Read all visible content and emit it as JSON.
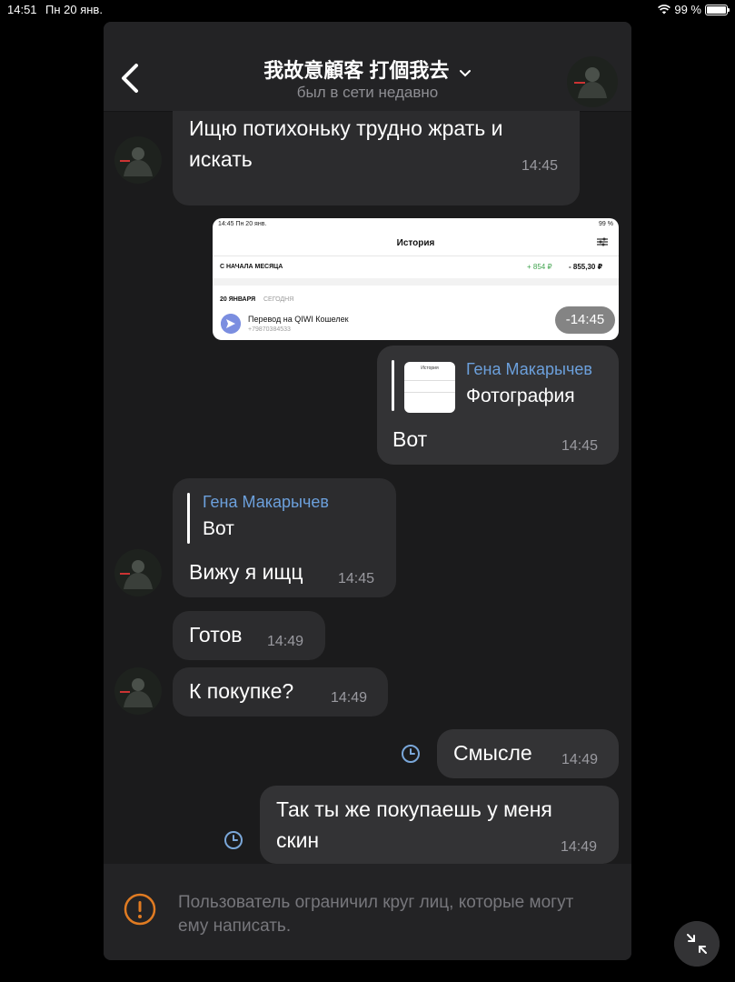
{
  "status_bar": {
    "time": "14:51",
    "date": "Пн 20 янв.",
    "battery": "99 %"
  },
  "chat": {
    "title": "我故意顧客 打個我去",
    "status": "был в сети недавно"
  },
  "messages": [
    {
      "direction": "in",
      "lines": [
        "Ищю потихоньку трудно жрать и",
        "искать"
      ],
      "time": "14:45"
    },
    {
      "direction": "out",
      "type": "image",
      "time": "14:45",
      "image": {
        "status_time": "14:45  Пн 20 янв.",
        "status_right": "99 %",
        "title": "История",
        "month_label": "С НАЧАЛА МЕСЯЦА",
        "income": "+ 854 ₽",
        "expense": "- 855,30 ₽",
        "date_label": "20 ЯНВАРЯ",
        "today_label": "СЕГОДНЯ",
        "tx_name": "Перевод на QIWI Кошелек",
        "tx_phone": "+79870384533",
        "tx_amount": "-14:45",
        "thumb_title": "История"
      }
    },
    {
      "direction": "out",
      "reply": {
        "name": "Гена Макарычев",
        "text": "Фотография"
      },
      "text": "Вот",
      "time": "14:45"
    },
    {
      "direction": "in",
      "reply": {
        "name": "Гена Макарычев",
        "text": "Вот"
      },
      "text": "Вижу я ищц",
      "time": "14:45"
    },
    {
      "direction": "in",
      "text": "Готов",
      "time": "14:49"
    },
    {
      "direction": "in",
      "text": "К покупке?",
      "time": "14:49"
    },
    {
      "direction": "out",
      "text": "Смысле",
      "time": "14:49",
      "state": "sending"
    },
    {
      "direction": "out",
      "lines": [
        "Так ты же покупаешь у меня",
        "скин"
      ],
      "time": "14:49",
      "state": "sending"
    }
  ],
  "footer": {
    "restriction_text": "Пользователь ограничил круг лиц, которые могут ему написать."
  },
  "colors": {
    "accent": "#6ca0dc",
    "warning": "#e07b22",
    "background": "#1b1b1c",
    "bubble": "#2c2c2e"
  }
}
